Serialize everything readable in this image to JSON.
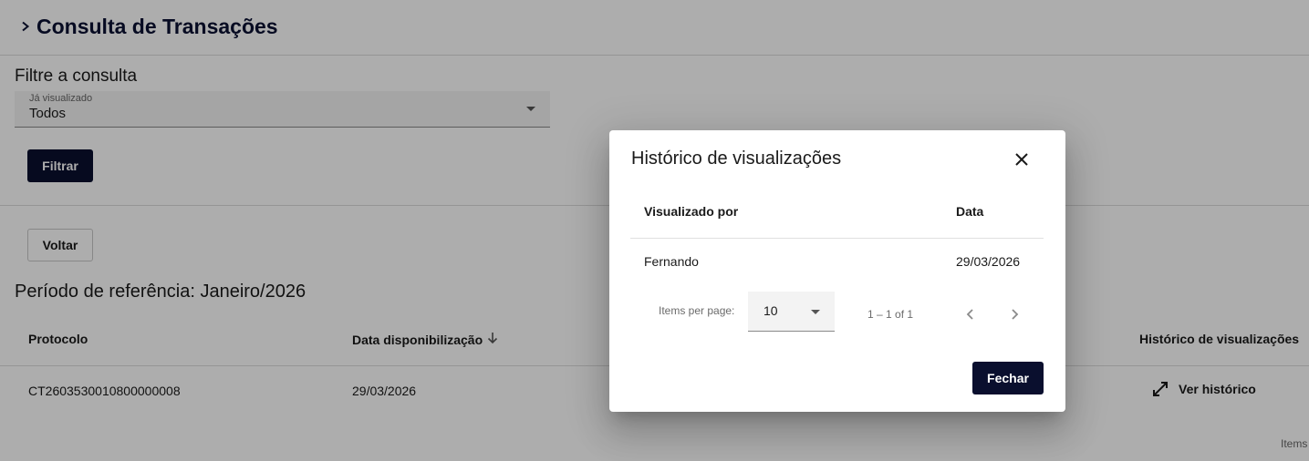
{
  "page": {
    "title": "Consulta de Transações",
    "filter_title": "Filtre a consulta",
    "filter": {
      "label": "Já visualizado",
      "value": "Todos"
    },
    "filter_button": "Filtrar",
    "back_button": "Voltar",
    "period_title": "Período de referência: Janeiro/2026",
    "table": {
      "headers": {
        "protocolo": "Protocolo",
        "data": "Data disponibilização",
        "historico": "Histórico de visualizações"
      },
      "rows": [
        {
          "protocolo": "CT2603530010800000008",
          "data": "29/03/2026",
          "action": "Ver histórico"
        }
      ]
    },
    "paginator_peek": "Items"
  },
  "dialog": {
    "title": "Histórico de visualizações",
    "headers": {
      "by": "Visualizado por",
      "date": "Data"
    },
    "rows": [
      {
        "by": "Fernando",
        "date": "29/03/2026"
      }
    ],
    "paginator": {
      "items_label": "Items per page:",
      "page_size": "10",
      "range": "1 – 1 of 1"
    },
    "close_button": "Fechar"
  },
  "colors": {
    "primary_dark": "#0a0f2e",
    "backdrop": "rgba(0,0,0,0.32)"
  },
  "icons": [
    "chevron-right-icon",
    "dropdown-caret-icon",
    "arrow-down-icon",
    "expand-diagonal-icon",
    "close-icon",
    "chevron-left-icon"
  ]
}
